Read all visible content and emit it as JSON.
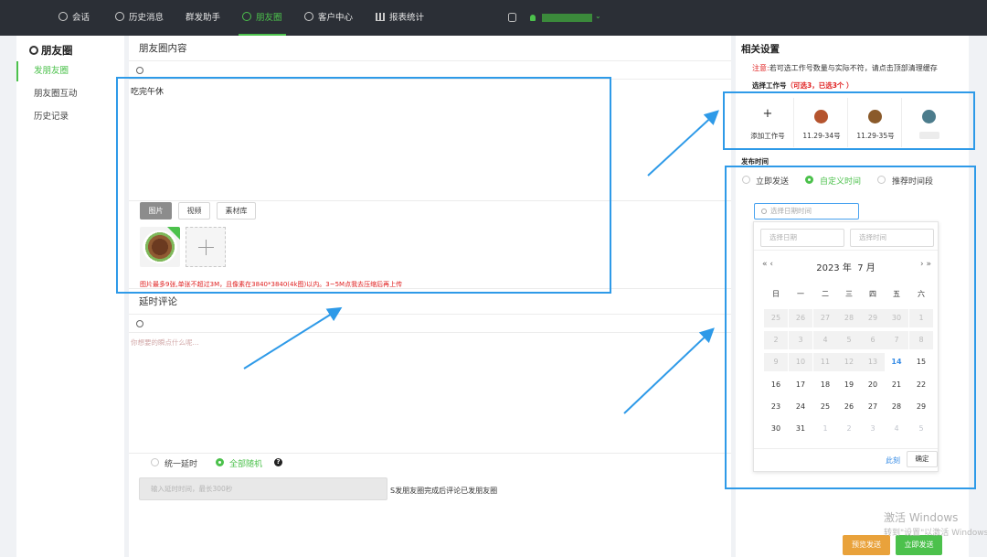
{
  "nav": {
    "items": [
      {
        "label": "会话",
        "icon": "chat-icon"
      },
      {
        "label": "历史消息",
        "icon": "clock-icon"
      },
      {
        "label": "群发助手",
        "icon": ""
      },
      {
        "label": "朋友圈",
        "icon": "moments-icon",
        "active": true
      },
      {
        "label": "客户中心",
        "icon": "user-icon"
      },
      {
        "label": "报表统计",
        "icon": "bar-chart-icon"
      }
    ]
  },
  "sidebar": {
    "title": "朋友圈",
    "items": [
      {
        "label": "发朋友圈",
        "active": true
      },
      {
        "label": "朋友圈互动"
      },
      {
        "label": "历史记录"
      }
    ]
  },
  "post": {
    "section_title": "朋友圈内容",
    "text": "吃完午休",
    "tabs": [
      "图片",
      "视频",
      "素材库"
    ],
    "active_tab": "图片",
    "warning": "图片最多9张,单张不超过3M，且像素在3840*3840(4k图)以内。3~5M点我去压缩后再上传"
  },
  "delay": {
    "section_title": "延时评论",
    "placeholder": "你想要的瞬点什么呢...",
    "options": [
      "统一延时",
      "全部随机"
    ],
    "selected": "全部随机",
    "input_placeholder": "输入延时时间，最长300秒",
    "note": "S发朋友圈完成后评论已发朋友圈"
  },
  "settings": {
    "title": "相关设置",
    "note_prefix": "注意:",
    "note_text": "若可选工作号数量与实际不符，请点击顶部清理缓存",
    "select_label": "选择工作号",
    "select_count": "（可选3，已选3个 ）",
    "accounts": [
      {
        "name": "添加工作号",
        "type": "add"
      },
      {
        "name": "11.29-34号",
        "color": "#b5542e"
      },
      {
        "name": "11.29-35号",
        "color": "#8a5a2a"
      },
      {
        "name": "",
        "color": "#4c7c8c"
      }
    ],
    "publish_label": "发布时间",
    "publish_options": [
      "立即发送",
      "自定义时间",
      "推荐时间段"
    ],
    "publish_selected": "自定义时间",
    "datetime_placeholder": "选择日期时间"
  },
  "datepicker": {
    "date_placeholder": "选择日期",
    "time_placeholder": "选择时间",
    "prev": "«  ‹",
    "next": "›  »",
    "year": "2023 年",
    "month": "7 月",
    "weekdays": [
      "日",
      "一",
      "二",
      "三",
      "四",
      "五",
      "六"
    ],
    "days": [
      [
        25,
        26,
        27,
        28,
        29,
        30,
        1
      ],
      [
        2,
        3,
        4,
        5,
        6,
        7,
        8
      ],
      [
        9,
        10,
        11,
        12,
        13,
        14,
        15
      ],
      [
        16,
        17,
        18,
        19,
        20,
        21,
        22
      ],
      [
        23,
        24,
        25,
        26,
        27,
        28,
        29
      ],
      [
        30,
        31,
        1,
        2,
        3,
        4,
        5
      ]
    ],
    "today": 14,
    "now_label": "此刻",
    "ok_label": "确定"
  },
  "buttons": {
    "preview": "预览发送",
    "send": "立即发送"
  },
  "watermark": {
    "line1": "激活 Windows",
    "line2": "转到\"设置\"以激活 Windows。"
  },
  "colors": {
    "accent": "#4cc14c",
    "annotation": "#2e9ae8",
    "warning": "#e02020",
    "preview_button": "#e9a23b"
  }
}
